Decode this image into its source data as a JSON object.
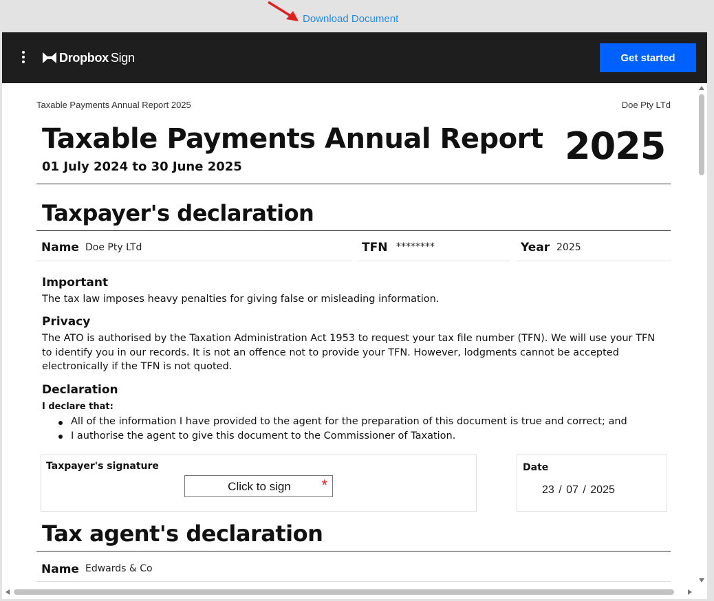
{
  "top": {
    "download_label": "Download Document"
  },
  "header": {
    "brand_name": "Dropbox",
    "brand_suffix": "Sign",
    "get_started_label": "Get started"
  },
  "doc": {
    "running_header_left": "Taxable Payments Annual Report 2025",
    "running_header_right": "Doe Pty LTd",
    "title": "Taxable Payments Annual Report",
    "year": "2025",
    "period": "01 July 2024 to 30 June 2025",
    "taxpayer_section": {
      "title": "Taxpayer's declaration",
      "name_label": "Name",
      "name_value": "Doe Pty LTd",
      "tfn_label": "TFN",
      "tfn_value": "********",
      "year_label": "Year",
      "year_value": "2025"
    },
    "important": {
      "heading": "Important",
      "text": "The tax law imposes heavy penalties for giving false or misleading information."
    },
    "privacy": {
      "heading": "Privacy",
      "text": "The ATO is authorised by the Taxation Administration Act 1953 to request your tax file number (TFN). We will use your TFN to identify you in our records. It is not an offence not to provide your TFN. However, lodgments cannot be accepted electronically if the TFN is not quoted."
    },
    "declaration": {
      "heading": "Declaration",
      "intro": "I declare that:",
      "bullets": [
        "All of the information I have provided to the agent for the preparation of this document is true and correct; and",
        "I authorise the agent to give this document to the Commissioner of Taxation."
      ]
    },
    "signature": {
      "label": "Taxpayer's signature",
      "button_label": "Click to sign",
      "required_mark": "*"
    },
    "date": {
      "label": "Date",
      "value": "23 / 07 / 2025"
    },
    "agent_section": {
      "title": "Tax agent's declaration",
      "name_label": "Name",
      "name_value": "Edwards & Co"
    }
  },
  "colors": {
    "accent": "#0061fe",
    "header_bg": "#1e1e1e",
    "link": "#2a8ad6",
    "required": "#d32727"
  }
}
